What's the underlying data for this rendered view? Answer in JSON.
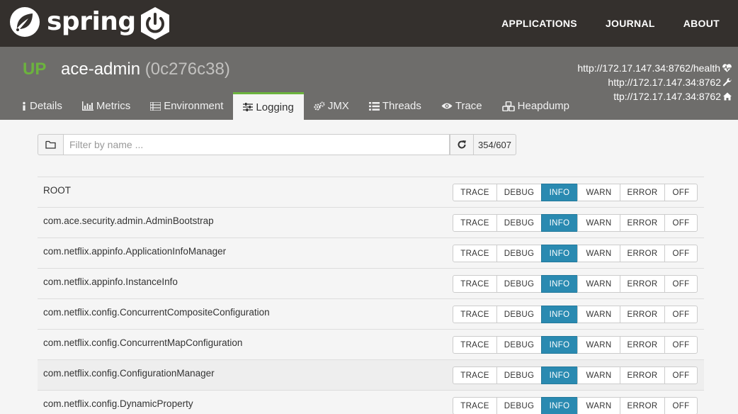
{
  "brand": {
    "name": "spring"
  },
  "nav": {
    "links": [
      "APPLICATIONS",
      "JOURNAL",
      "ABOUT"
    ]
  },
  "app": {
    "status": "UP",
    "name": "ace-admin",
    "id": "(0c276c38)",
    "urls": {
      "health": "http://172.17.147.34:8762/health",
      "management": "http://172.17.147.34:8762",
      "service": "ttp://172.17.147.34:8762"
    }
  },
  "tabs": [
    {
      "label": "Details",
      "icon": "info-icon"
    },
    {
      "label": "Metrics",
      "icon": "bar-chart-icon"
    },
    {
      "label": "Environment",
      "icon": "list-icon"
    },
    {
      "label": "Logging",
      "icon": "sliders-icon"
    },
    {
      "label": "JMX",
      "icon": "gears-icon"
    },
    {
      "label": "Threads",
      "icon": "list-icon"
    },
    {
      "label": "Trace",
      "icon": "eye-icon"
    },
    {
      "label": "Heapdump",
      "icon": "cubes-icon"
    }
  ],
  "active_tab": "Logging",
  "filter": {
    "placeholder": "Filter by name ...",
    "count": "354/607"
  },
  "levels": [
    "TRACE",
    "DEBUG",
    "INFO",
    "WARN",
    "ERROR",
    "OFF"
  ],
  "loggers": [
    {
      "name": "ROOT",
      "level": "INFO"
    },
    {
      "name": "com.ace.security.admin.AdminBootstrap",
      "level": "INFO"
    },
    {
      "name": "com.netflix.appinfo.ApplicationInfoManager",
      "level": "INFO"
    },
    {
      "name": "com.netflix.appinfo.InstanceInfo",
      "level": "INFO"
    },
    {
      "name": "com.netflix.config.ConcurrentCompositeConfiguration",
      "level": "INFO"
    },
    {
      "name": "com.netflix.config.ConcurrentMapConfiguration",
      "level": "INFO"
    },
    {
      "name": "com.netflix.config.ConfigurationManager",
      "level": "INFO"
    },
    {
      "name": "com.netflix.config.DynamicProperty",
      "level": "INFO"
    }
  ],
  "colors": {
    "navbar": "#34302d",
    "header": "#6e6d6b",
    "accent_green": "#6cb33e",
    "active_level": "#2a8ab1"
  }
}
